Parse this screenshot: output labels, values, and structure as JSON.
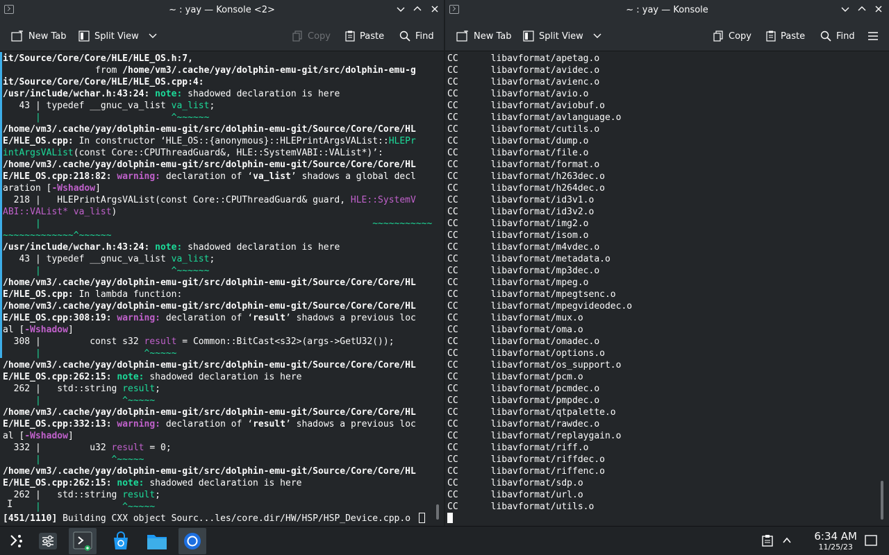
{
  "left_window": {
    "title": "~ : yay — Konsole <2>",
    "toolbar": {
      "new_tab": "New Tab",
      "split_view": "Split View",
      "copy": "Copy",
      "paste": "Paste",
      "find": "Find"
    },
    "lines": [
      "it/Source/Core/Core/HLE/HLE_OS.h:7,",
      "                 from /home/vm3/.cache/yay/dolphin-emu-git/src/dolphin-emu-g",
      "it/Source/Core/Core/HLE/HLE_OS.cpp:4:",
      "/usr/include/wchar.h:43:24: note: shadowed declaration is here",
      "   43 | typedef __gnuc_va_list va_list;",
      "      |                        ^~~~~~~",
      "/home/vm3/.cache/yay/dolphin-emu-git/src/dolphin-emu-git/Source/Core/Core/HL",
      "E/HLE_OS.cpp: In constructor ‘HLE_OS::{anonymous}::HLEPrintArgsVAList::HLEPr",
      "intArgsVAList(const Core::CPUThreadGuard&, HLE::SystemVABI::VAList*)’:",
      "/home/vm3/.cache/yay/dolphin-emu-git/src/dolphin-emu-git/Source/Core/Core/HL",
      "E/HLE_OS.cpp:218:82: warning: declaration of ‘va_list’ shadows a global decl",
      "aration [-Wshadow]",
      "  218 |   HLEPrintArgsVAList(const Core::CPUThreadGuard& guard, HLE::SystemV",
      "ABI::VAList* va_list)",
      "      |                                                             ~~~~~~~~~~~",
      "~~~~~~~~~~~~~^~~~~~~",
      "/usr/include/wchar.h:43:24: note: shadowed declaration is here",
      "   43 | typedef __gnuc_va_list va_list;",
      "      |                        ^~~~~~~",
      "/home/vm3/.cache/yay/dolphin-emu-git/src/dolphin-emu-git/Source/Core/Core/HL",
      "E/HLE_OS.cpp: In lambda function:",
      "/home/vm3/.cache/yay/dolphin-emu-git/src/dolphin-emu-git/Source/Core/Core/HL",
      "E/HLE_OS.cpp:308:19: warning: declaration of ‘result’ shadows a previous loc",
      "al [-Wshadow]",
      "  308 |         const s32 result = Common::BitCast<s32>(args->GetU32());",
      "      |                   ^~~~~~",
      "/home/vm3/.cache/yay/dolphin-emu-git/src/dolphin-emu-git/Source/Core/Core/HL",
      "E/HLE_OS.cpp:262:15: note: shadowed declaration is here",
      "  262 |   std::string result;",
      "      |               ^~~~~~",
      "/home/vm3/.cache/yay/dolphin-emu-git/src/dolphin-emu-git/Source/Core/Core/HL",
      "E/HLE_OS.cpp:332:13: warning: declaration of ‘result’ shadows a previous loc",
      "al [-Wshadow]",
      "  332 |         u32 result = 0;",
      "      |             ^~~~~~",
      "/home/vm3/.cache/yay/dolphin-emu-git/src/dolphin-emu-git/Source/Core/Core/HL",
      "E/HLE_OS.cpp:262:15: note: shadowed declaration is here",
      "  262 |   std::string result;",
      "      |               ^~~~~~",
      "[451/1110] Building CXX object Sourc...les/core.dir/HW/HSP/HSP_Device.cpp.o"
    ]
  },
  "right_window": {
    "title": "~ : yay — Konsole",
    "toolbar": {
      "new_tab": "New Tab",
      "split_view": "Split View",
      "copy": "Copy",
      "paste": "Paste",
      "find": "Find"
    },
    "compile_prefix": "CC",
    "objects": [
      "libavformat/apetag.o",
      "libavformat/avidec.o",
      "libavformat/avienc.o",
      "libavformat/avio.o",
      "libavformat/aviobuf.o",
      "libavformat/avlanguage.o",
      "libavformat/cutils.o",
      "libavformat/dump.o",
      "libavformat/file.o",
      "libavformat/format.o",
      "libavformat/h263dec.o",
      "libavformat/h264dec.o",
      "libavformat/id3v1.o",
      "libavformat/id3v2.o",
      "libavformat/img2.o",
      "libavformat/isom.o",
      "libavformat/m4vdec.o",
      "libavformat/metadata.o",
      "libavformat/mp3dec.o",
      "libavformat/mpeg.o",
      "libavformat/mpegtsenc.o",
      "libavformat/mpegvideodec.o",
      "libavformat/mux.o",
      "libavformat/oma.o",
      "libavformat/omadec.o",
      "libavformat/options.o",
      "libavformat/os_support.o",
      "libavformat/pcm.o",
      "libavformat/pcmdec.o",
      "libavformat/pmpdec.o",
      "libavformat/qtpalette.o",
      "libavformat/rawdec.o",
      "libavformat/replaygain.o",
      "libavformat/riff.o",
      "libavformat/riffdec.o",
      "libavformat/riffenc.o",
      "libavformat/sdp.o",
      "libavformat/url.o",
      "libavformat/utils.o"
    ]
  },
  "taskbar": {
    "apps": [
      "application-launcher-icon",
      "system-settings-icon",
      "konsole-icon",
      "discover-store-icon",
      "dolphin-file-manager-icon",
      "chromium-browser-icon"
    ],
    "clock_time": "6:34 AM",
    "clock_date": "11/25/23"
  },
  "colors": {
    "background": "#232629",
    "titlebar": "#2a2e32",
    "note": "#1cdc9a",
    "warning": "#c061cb"
  }
}
